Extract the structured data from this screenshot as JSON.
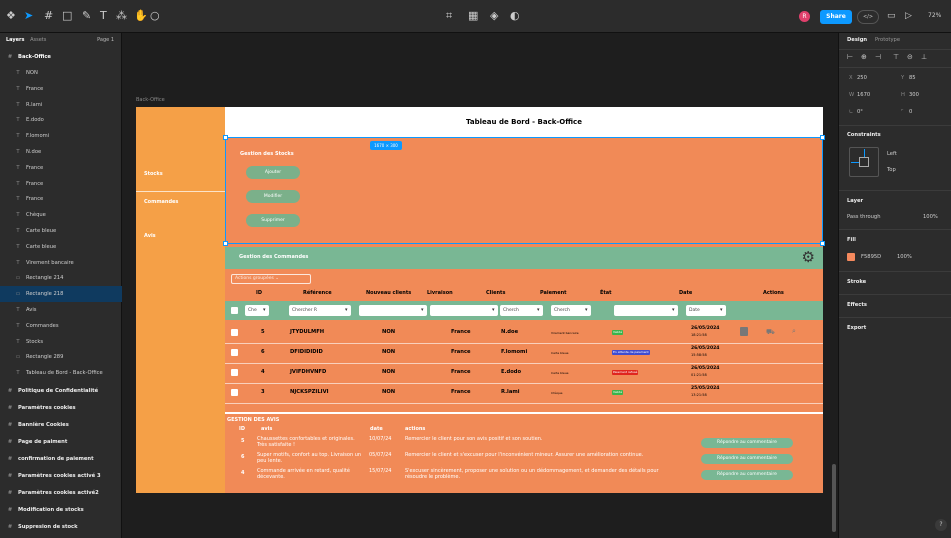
{
  "topbar": {
    "zoom": "72%",
    "share_label": "Share",
    "code_label": "</>",
    "avatar_letter": "R",
    "center_icons": [
      "frame-icon",
      "layout-icon",
      "component-icon",
      "contrast-icon"
    ],
    "left_icons": [
      "figma-menu-icon",
      "move-icon",
      "frame-tool-icon",
      "shape-tool-icon",
      "pen-tool-icon",
      "text-tool-icon",
      "component-tool-icon",
      "hand-tool-icon",
      "comment-icon"
    ]
  },
  "leftpanel": {
    "tab_layers": "Layers",
    "tab_assets": "Assets",
    "page": "Page 1",
    "frame_name": "Back-Office",
    "layers": [
      {
        "label": "NON",
        "glyph": "T",
        "sel": false
      },
      {
        "label": "France",
        "glyph": "T",
        "sel": false
      },
      {
        "label": "R.lami",
        "glyph": "T",
        "sel": false
      },
      {
        "label": "E.dodo",
        "glyph": "T",
        "sel": false
      },
      {
        "label": "F.lomomi",
        "glyph": "T",
        "sel": false
      },
      {
        "label": "N.doe",
        "glyph": "T",
        "sel": false
      },
      {
        "label": "France",
        "glyph": "T",
        "sel": false
      },
      {
        "label": "France",
        "glyph": "T",
        "sel": false
      },
      {
        "label": "France",
        "glyph": "T",
        "sel": false
      },
      {
        "label": "Chèque",
        "glyph": "T",
        "sel": false
      },
      {
        "label": "Carte bleue",
        "glyph": "T",
        "sel": false
      },
      {
        "label": "Carte bleue",
        "glyph": "T",
        "sel": false
      },
      {
        "label": "Virement bancaire",
        "glyph": "T",
        "sel": false
      },
      {
        "label": "Rectangle 214",
        "glyph": "▭",
        "sel": false
      },
      {
        "label": "Rectangle 218",
        "glyph": "▭",
        "sel": true
      },
      {
        "label": "Avis",
        "glyph": "T",
        "sel": false
      },
      {
        "label": "Commandes",
        "glyph": "T",
        "sel": false
      },
      {
        "label": "Stocks",
        "glyph": "T",
        "sel": false
      },
      {
        "label": "Rectangle 289",
        "glyph": "▭",
        "sel": false
      },
      {
        "label": "Tableau de Bord - Back-Office",
        "glyph": "T",
        "sel": false
      }
    ],
    "frames": [
      "Politique de Confidentialité",
      "Paramètres cookies",
      "Bannière Cookies",
      "Page de paiment",
      "confirmation de paiement",
      "Paramètres cookies activé 3",
      "Paramètres cookies activé2",
      "Modification de stocks",
      "Suppresion de stock"
    ]
  },
  "rightpanel": {
    "tab_design": "Design",
    "tab_prototype": "Prototype",
    "x": "250",
    "y": "85",
    "w": "1670",
    "h": "300",
    "rotation": "0°",
    "radius": "0",
    "constraints_title": "Constraints",
    "constraint_h": "Left",
    "constraint_v": "Top",
    "layer_title": "Layer",
    "blend": "Pass through",
    "opacity": "100%",
    "fill_title": "Fill",
    "fill_hex": "F5895D",
    "fill_opacity": "100%",
    "fill_color": "#F5895D",
    "stroke_title": "Stroke",
    "effects_title": "Effects",
    "export_title": "Export",
    "help": "?"
  },
  "canvas": {
    "frame_label": "Back-Office",
    "size_badge": "1670 × 300",
    "sidebar": {
      "stocks": "Stocks",
      "commandes": "Commandes",
      "avis": "Avis"
    },
    "header_title": "Tableau de Bord - Back-Office",
    "stock": {
      "title": "Gestion des Stocks",
      "buttons": [
        "Ajouter",
        "Modifier",
        "Supprimer"
      ]
    },
    "commands": {
      "title": "Gestion des Commandes",
      "actions_group": "Actions groupées",
      "headers": [
        "ID",
        "Référence",
        "Nouveau clients",
        "Livraison",
        "Clients",
        "Paiement",
        "État",
        "Date",
        "Actions"
      ],
      "filters": [
        "Che",
        "Chercher R",
        "",
        "",
        "Cherch",
        "Cherch",
        "",
        "Date"
      ],
      "rows": [
        {
          "id": "5",
          "ref": "JTYDULMFH",
          "nouveau": "NON",
          "livraison": "France",
          "client": "N.doe",
          "paiement": "Virement bancaire",
          "etat": "Validé",
          "date": "26/05/2024",
          "time": "18:21:58"
        },
        {
          "id": "6",
          "ref": "DFIDIDIDID",
          "nouveau": "NON",
          "livraison": "France",
          "client": "F.lomomi",
          "paiement": "Carte bleue",
          "etat": "En attente de paiement",
          "date": "26/05/2024",
          "time": "15:58:58"
        },
        {
          "id": "4",
          "ref": "JVIFDHVNFD",
          "nouveau": "NON",
          "livraison": "France",
          "client": "E.dodo",
          "paiement": "Carte bleue",
          "etat": "Paiement refusé",
          "date": "26/05/2024",
          "time": "01:21:58"
        },
        {
          "id": "3",
          "ref": "NJCKSPZILIVI",
          "nouveau": "NON",
          "livraison": "France",
          "client": "R.lami",
          "paiement": "Chèque",
          "etat": "Validé",
          "date": "25/05/2024",
          "time": "13:21:58"
        }
      ]
    },
    "avis": {
      "title": "GESTION DES AVIS",
      "headers": [
        "ID",
        "avis",
        "date",
        "actions"
      ],
      "rows": [
        {
          "id": "5",
          "avis": "Chaussettes confortables et originales. Très satisfaite !",
          "date": "10/07/24",
          "action": "Remercier le client pour son avis positif et son soutien.",
          "btn": "Répondre au commentaire"
        },
        {
          "id": "6",
          "avis": "Super motifs, confort au top. Livraison un peu lente.",
          "date": "05/07/24",
          "action": "Remercier le client et s'excuser pour l'inconvénient mineur. Assurer une amélioration continue.",
          "btn": "Répondre au commentaire"
        },
        {
          "id": "4",
          "avis": "Commande arrivée en retard, qualité décevante.",
          "date": "15/07/24",
          "action": "S'excuser sincèrement, proposer une solution ou un dédommagement, et demander des détails pour résoudre le problème.",
          "btn": "Répondre au commentaire"
        }
      ]
    }
  }
}
